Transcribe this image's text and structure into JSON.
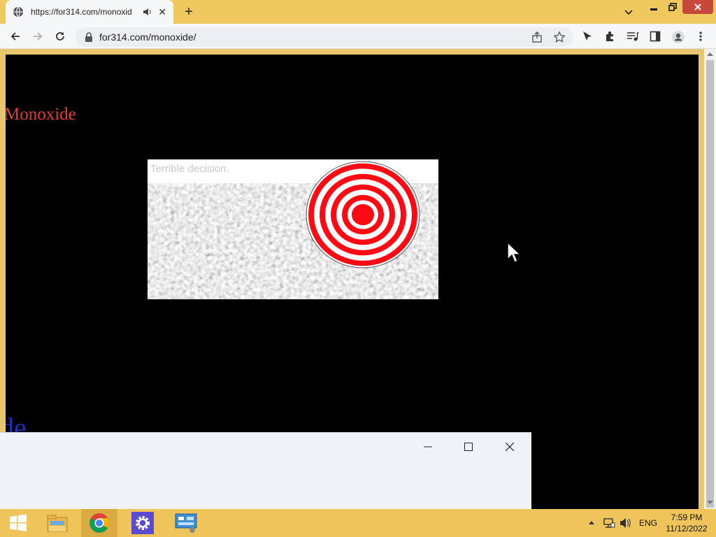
{
  "browser": {
    "tab_title": "https://for314.com/monoxid",
    "url": "for314.com/monoxide/"
  },
  "page": {
    "heading": "Monoxide",
    "popup_text": "Terrible decision.",
    "bottom_text": "de"
  },
  "taskbar": {
    "language": "ENG",
    "time": "7:59 PM",
    "date": "11/12/2022"
  },
  "colors": {
    "heading": "#e53a3a",
    "bottom_text": "#1a2fbd",
    "target_red": "#ff0a14",
    "taskbar": "#efc55b"
  }
}
